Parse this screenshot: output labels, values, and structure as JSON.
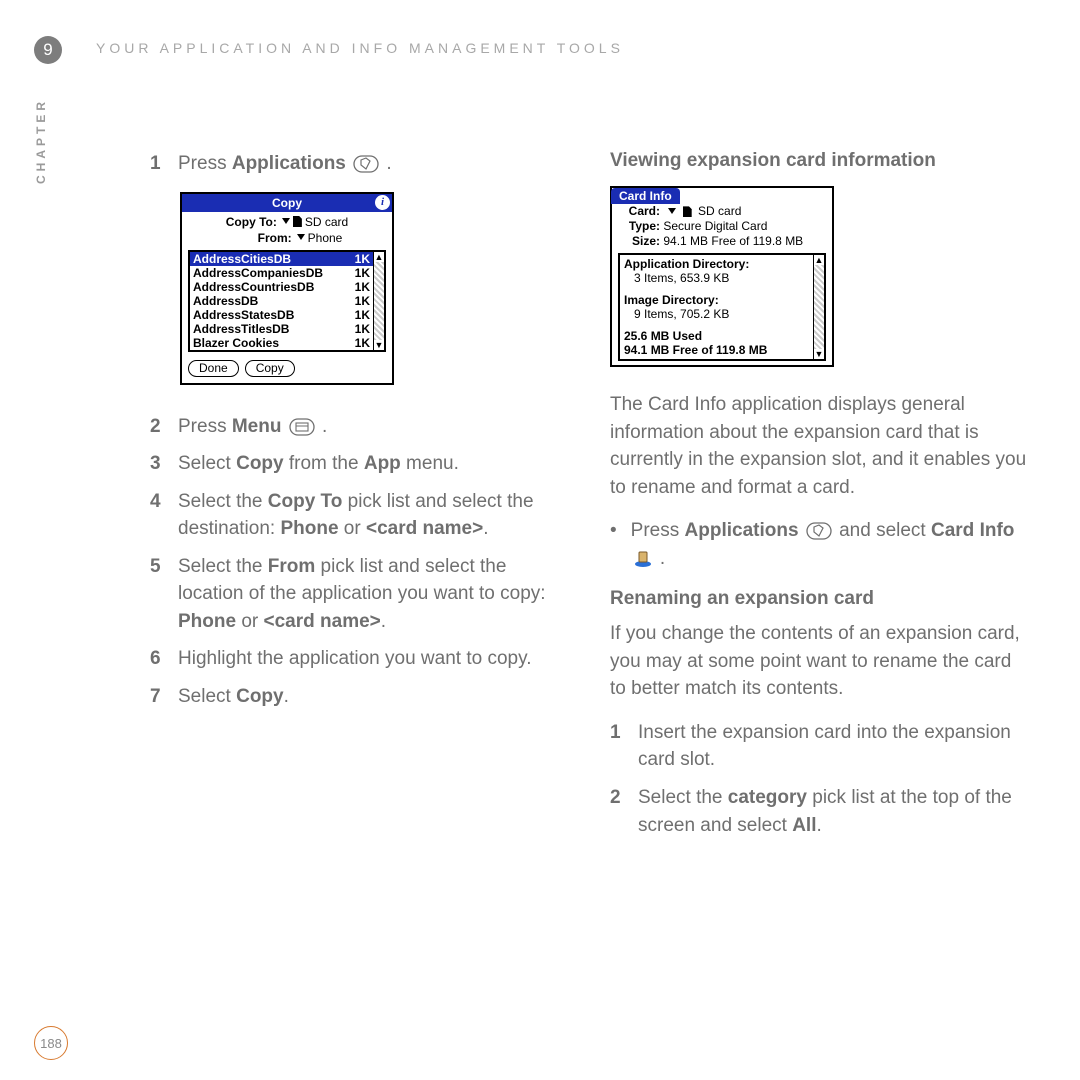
{
  "chapter": {
    "number": "9",
    "label": "CHAPTER"
  },
  "header": "YOUR APPLICATION AND INFO MANAGEMENT TOOLS",
  "left": {
    "step1": {
      "n": "1",
      "pre": "Press ",
      "b": "Applications",
      "post": " ."
    },
    "copy_dialog": {
      "title": "Copy",
      "copy_to_label": "Copy To:",
      "copy_to_value": "SD card",
      "from_label": "From:",
      "from_value": "Phone",
      "items": [
        {
          "name": "AddressCitiesDB",
          "size": "1K",
          "selected": true
        },
        {
          "name": "AddressCompaniesDB",
          "size": "1K"
        },
        {
          "name": "AddressCountriesDB",
          "size": "1K"
        },
        {
          "name": "AddressDB",
          "size": "1K"
        },
        {
          "name": "AddressStatesDB",
          "size": "1K"
        },
        {
          "name": "AddressTitlesDB",
          "size": "1K"
        },
        {
          "name": "Blazer Cookies",
          "size": "1K"
        }
      ],
      "done": "Done",
      "copy": "Copy"
    },
    "step2": {
      "n": "2",
      "pre": "Press ",
      "b": "Menu",
      "post": " ."
    },
    "step3": {
      "n": "3",
      "pre": "Select ",
      "b1": "Copy",
      "mid": " from the ",
      "b2": "App",
      "post": " menu."
    },
    "step4": {
      "n": "4",
      "pre": "Select the ",
      "b1": "Copy To",
      "mid1": " pick list and select the destination: ",
      "b2": "Phone",
      "mid2": " or ",
      "b3": "<card name>",
      "post": "."
    },
    "step5": {
      "n": "5",
      "pre": "Select the ",
      "b1": "From",
      "mid1": " pick list and select the location of the application you want to copy: ",
      "b2": "Phone",
      "mid2": " or ",
      "b3": "<card name>",
      "post": "."
    },
    "step6": {
      "n": "6",
      "text": "Highlight the application you want to copy."
    },
    "step7": {
      "n": "7",
      "pre": "Select ",
      "b": "Copy",
      "post": "."
    }
  },
  "right": {
    "h1": "Viewing expansion card information",
    "cardinfo": {
      "tab": "Card Info",
      "card_label": "Card:",
      "card_value": "SD card",
      "type_label": "Type:",
      "type_value": "Secure Digital Card",
      "size_label": "Size:",
      "size_value": "94.1 MB Free of 119.8 MB",
      "appdir_label": "Application Directory:",
      "appdir_value": "3 Items, 653.9 KB",
      "imgdir_label": "Image Directory:",
      "imgdir_value": "9 Items, 705.2 KB",
      "used": "25.6 MB Used",
      "free": "94.1 MB Free of 119.8 MB"
    },
    "para1": "The Card Info application displays general information about the expansion card that is currently in the expansion slot, and it enables you to rename and format a card.",
    "bullet": {
      "pre": "Press ",
      "b1": "Applications",
      "mid": " and select ",
      "b2": "Card Info",
      "post": " ."
    },
    "h2": "Renaming an expansion card",
    "para2": "If you change the contents of an expansion card, you may at some point want to rename the card to better match its contents.",
    "r1": {
      "n": "1",
      "text": "Insert the expansion card into the expansion card slot."
    },
    "r2": {
      "n": "2",
      "pre": "Select the ",
      "b1": "category",
      "mid": " pick list at the top of the screen and select ",
      "b2": "All",
      "post": "."
    }
  },
  "page": "188"
}
